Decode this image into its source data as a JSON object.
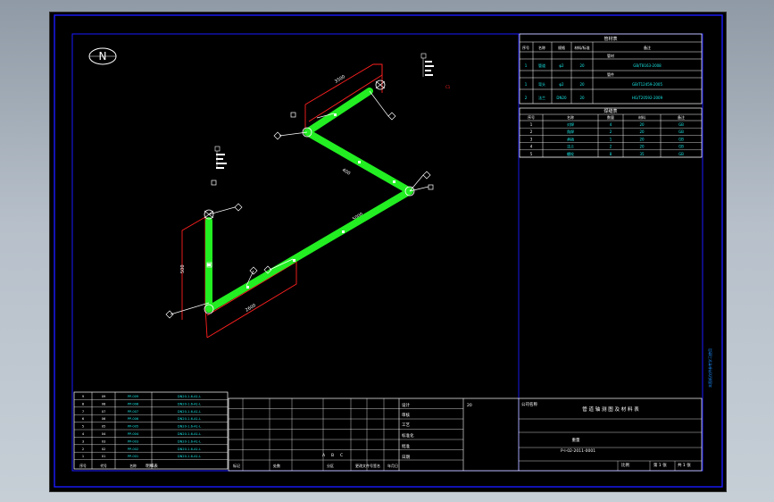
{
  "north_symbol": "N",
  "colors": {
    "background": "#000000",
    "frame": "#1a1aff",
    "pipe": "#22ee22",
    "dimension": "#ff2020",
    "text": "#ffffff",
    "table_text": "#19e6e6"
  },
  "dimension_labels": [
    "500",
    "2600",
    "3500",
    "400",
    "5000"
  ],
  "tag_labels": [
    "C1"
  ],
  "spec_table": {
    "title": "管材表",
    "headers": [
      "序号",
      "名称",
      "规格",
      "材料/标准",
      "备注"
    ],
    "section_labels": [
      "管材",
      "管件"
    ],
    "rows": [
      {
        "no": "1",
        "name": "管道",
        "spec": "φ2",
        "mat": "20",
        "note": "GB/T8163-2008"
      },
      {
        "no": "1",
        "name": "弯头",
        "spec": "φ2",
        "mat": "20",
        "note": "GB/T12459-2005"
      },
      {
        "no": "2",
        "name": "法兰",
        "spec": "DN20",
        "mat": "20",
        "note": "HG/T20592-2009"
      }
    ]
  },
  "weld_table": {
    "title": "焊缝表",
    "headers": [
      "序号",
      "名称",
      "数量",
      "材料",
      "备注"
    ],
    "rows": [
      {
        "no": "1",
        "name": "对焊",
        "qty": "4",
        "mat": "20",
        "note": "GB"
      },
      {
        "no": "2",
        "name": "角焊",
        "qty": "2",
        "mat": "20",
        "note": "GB"
      },
      {
        "no": "3",
        "name": "承插",
        "qty": "1",
        "mat": "20",
        "note": "GB"
      },
      {
        "no": "4",
        "name": "法兰",
        "qty": "2",
        "mat": "20",
        "note": "GB"
      },
      {
        "no": "5",
        "name": "螺栓",
        "qty": "8",
        "mat": "35",
        "note": "GB"
      }
    ]
  },
  "bom_table": {
    "header": "明细表",
    "footer_cols": [
      "序号",
      "代号",
      "名称",
      "数量"
    ],
    "rows": [
      [
        "9",
        "09",
        "PP-009",
        "DN20-1.6-A1-L"
      ],
      [
        "8",
        "08",
        "PP-008",
        "DN20-1.6-A1-L"
      ],
      [
        "7",
        "07",
        "PP-007",
        "DN20-1.6-A1-L"
      ],
      [
        "6",
        "06",
        "PP-006",
        "DN20-1.6-A1-L"
      ],
      [
        "5",
        "05",
        "PP-005",
        "DN20-1.6-A1-L"
      ],
      [
        "4",
        "04",
        "PP-004",
        "DN20-1.6-A1-L"
      ],
      [
        "3",
        "03",
        "PP-003",
        "DN20-1.6-A1-L"
      ],
      [
        "2",
        "02",
        "PP-002",
        "DN20-1.6-A1-L"
      ],
      [
        "1",
        "01",
        "PP-001",
        "DN20-1.6-A1-L"
      ]
    ]
  },
  "title_block": {
    "design_labels": [
      "设计",
      "审核",
      "工艺",
      "标准化",
      "批准",
      "日期"
    ],
    "project_title": "管 道 轴 测 图 及 材 料 表",
    "drawing_no": "P-I-02-2011-0001",
    "material": "20",
    "scale_label": "比例",
    "sheet_label": "第 1 张",
    "sheet_total": "共 1 张",
    "weight_label": "重量",
    "company": "公司名称",
    "stage_marks": [
      "A",
      "B",
      "C"
    ],
    "footer_signs": [
      "标记",
      "处数",
      "分区",
      "更改文件号",
      "签名",
      "年月日"
    ]
  },
  "side_note": "本图纸仅供参考学习使用"
}
